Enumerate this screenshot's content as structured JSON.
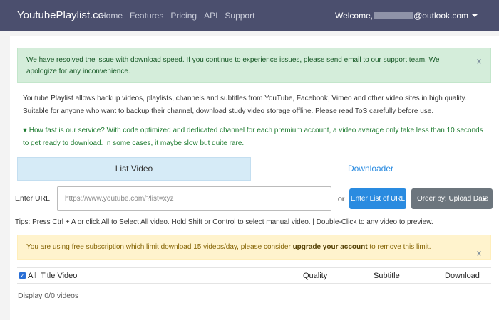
{
  "navbar": {
    "brand": "YoutubePlaylist.cc",
    "links": [
      "Home",
      "Features",
      "Pricing",
      "API",
      "Support"
    ],
    "welcome_prefix": "Welcome,",
    "welcome_suffix": "@outlook.com"
  },
  "alert_success": {
    "text": "We have resolved the issue with download speed. If you continue to experience issues, please send email to our support team. We apologize for any inconvenience.",
    "close": "×"
  },
  "description": "Youtube Playlist allows backup videos, playlists, channels and subtitles from YouTube, Facebook, Vimeo and other video sites in high quality. Suitable for anyone who want to backup their channel, download study video storage offline. Please read ToS carefully before use.",
  "speed_note": {
    "icon": "heart-icon",
    "text": "How fast is our service? With code optimized and dedicated channel for each premium account, a video average only take less than 10 seconds to get ready to download. In some cases, it maybe slow but quite rare."
  },
  "tabs": {
    "list_video": "List Video",
    "downloader": "Downloader"
  },
  "url_form": {
    "label": "Enter URL",
    "placeholder": "https://www.youtube.com/?list=xyz",
    "or": "or",
    "enter_list_button": "Enter List of URL",
    "order_button": "Order by: Upload Date"
  },
  "tips": "Tips: Press Ctrl + A or click All to Select All video. Hold Shift or Control to select manual video. | Double-Click to any video to preview.",
  "alert_warning": {
    "text_before": "You are using free subscription which limit download 15 videos/day, please consider",
    "link": "upgrade your account",
    "text_after": "to remove this limit.",
    "close": "×"
  },
  "table": {
    "all": "All",
    "title": "Title Video",
    "quality": "Quality",
    "subtitle": "Subtitle",
    "download": "Download"
  },
  "display_count": "Display 0/0 videos",
  "colors": {
    "navbar": "#4b4f6e",
    "primary": "#2a8be0",
    "success_bg": "#d4edda",
    "warning_bg": "#fff3cd"
  }
}
